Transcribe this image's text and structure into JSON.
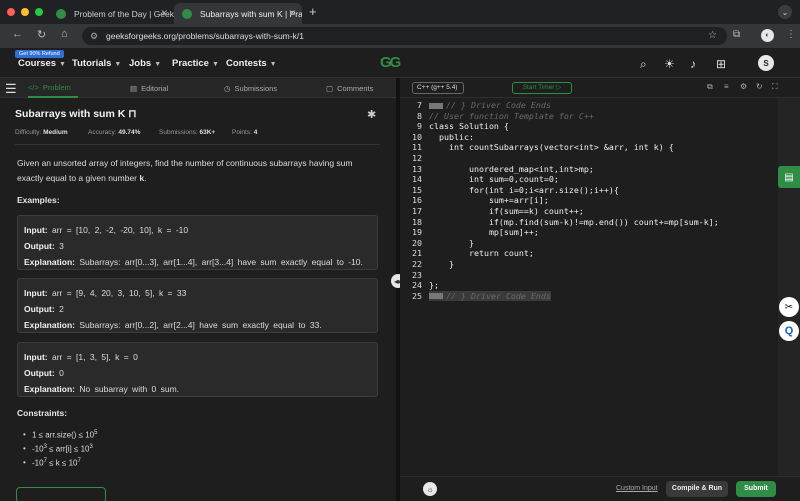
{
  "browser": {
    "tabs": [
      {
        "title": "Problem of the Day | Geeksfo"
      },
      {
        "title": "Subarrays with sum K | Practi"
      }
    ],
    "url": "geeksforgeeks.org/problems/subarrays-with-sum-k/1",
    "profile_initial": ""
  },
  "site": {
    "refund_badge": "Get 90% Refund",
    "logo": "GG",
    "menu": [
      "Courses",
      "Tutorials",
      "Jobs",
      "Practice",
      "Contests"
    ],
    "user_initial": "S",
    "accent": "#2f8d46"
  },
  "left_tabs": [
    "Problem",
    "Editorial",
    "Submissions",
    "Comments"
  ],
  "problem": {
    "title": "Subarrays with sum K",
    "difficulty_label": "Difficulty:",
    "difficulty": "Medium",
    "accuracy_label": "Accuracy:",
    "accuracy": "49.74%",
    "submissions_label": "Submissions:",
    "submissions": "63K+",
    "points_label": "Points:",
    "points": "4",
    "description_pre": "Given an unsorted array of integers, find the number of continuous subarrays having sum exactly equal to a given number ",
    "description_k": "k",
    "description_post": ".",
    "examples_heading": "Examples:",
    "examples": [
      {
        "input": "arr = [10, 2, -2, -20, 10], k = -10",
        "output": "3",
        "explanation": "Subarrays: arr[0...3], arr[1...4], arr[3...4] have sum exactly equal to -10."
      },
      {
        "input": "arr = [9, 4, 20, 3, 10, 5], k = 33",
        "output": "2",
        "explanation": "Subarrays: arr[0...2], arr[2...4] have sum exactly equal to 33."
      },
      {
        "input": "arr = [1, 3, 5], k = 0",
        "output": "0",
        "explanation": "No subarray with 0 sum."
      }
    ],
    "labels": {
      "input": "Input:",
      "output": "Output:",
      "explanation": "Explanation:"
    },
    "constraints_heading": "Constraints:",
    "constraints": [
      {
        "a": "1 ≤ arr.size() ≤ 10",
        "sup": "5",
        "b": ""
      },
      {
        "a": "-10",
        "sup": "3",
        "b": " ≤ arr[i] ≤ 10",
        "sup2": "3"
      },
      {
        "a": "-10",
        "sup": "7",
        "b": " ≤ k ≤ 10",
        "sup2": "7"
      }
    ]
  },
  "editor": {
    "language": "C++ (g++ 5.4)",
    "timer": "Start Timer",
    "lines": [
      {
        "n": "7",
        "text": "// } Driver Code Ends"
      },
      {
        "n": "8",
        "text": "// User function Template for C++"
      },
      {
        "n": "9",
        "text": "class Solution {"
      },
      {
        "n": "10",
        "text": "  public:"
      },
      {
        "n": "11",
        "text": "    int countSubarrays(vector<int> &arr, int k) {"
      },
      {
        "n": "12",
        "text": ""
      },
      {
        "n": "13",
        "text": "        unordered_map<int,int>mp;"
      },
      {
        "n": "14",
        "text": "        int sum=0,count=0;"
      },
      {
        "n": "15",
        "text": "        for(int i=0;i<arr.size();i++){"
      },
      {
        "n": "16",
        "text": "            sum+=arr[i];"
      },
      {
        "n": "17",
        "text": "            if(sum==k) count++;"
      },
      {
        "n": "18",
        "text": "            if(mp.find(sum-k)!=mp.end()) count+=mp[sum-k];"
      },
      {
        "n": "19",
        "text": "            mp[sum]++;"
      },
      {
        "n": "20",
        "text": "        }"
      },
      {
        "n": "21",
        "text": "        return count;"
      },
      {
        "n": "22",
        "text": "    }"
      },
      {
        "n": "23",
        "text": ""
      },
      {
        "n": "24",
        "text": "};"
      },
      {
        "n": "25",
        "text": "// } Driver Code Ends"
      }
    ],
    "custom_input": "Custom Input",
    "compile_run": "Compile & Run",
    "submit": "Submit"
  }
}
